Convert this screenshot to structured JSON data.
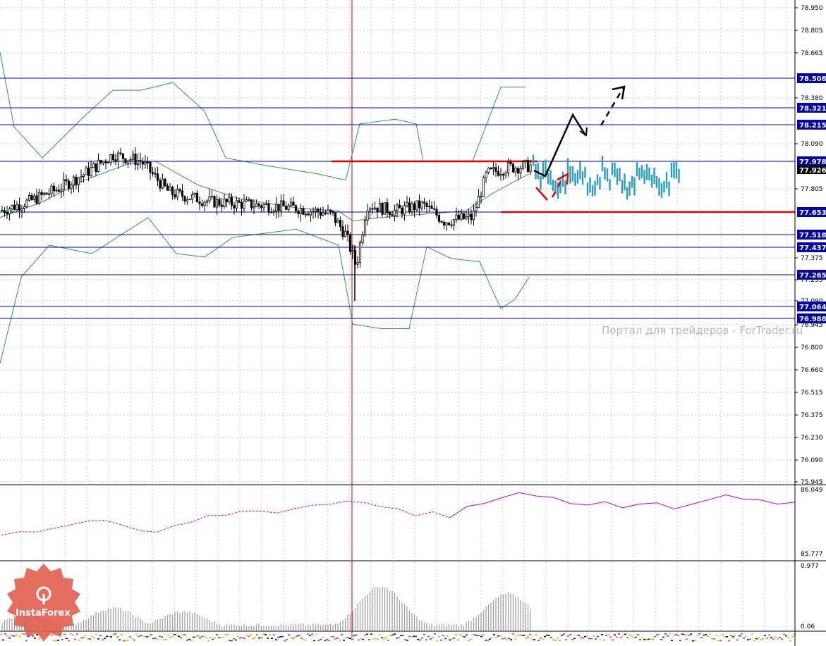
{
  "colors": {
    "background": "#ffffff",
    "grid": "#c8c8c8",
    "level_line": "#0000aa",
    "support_resistance": "#e00000",
    "bollinger": "#2e9a52",
    "candles": "#000000",
    "forecast": "#2a9bc0",
    "oscillator": "#cc00cc",
    "event_line": "#cc0000",
    "badge_bg": "#0000aa",
    "current_badge_bg": "#000000",
    "brand": "#e05a4a"
  },
  "watermark": "Портал для трейдеров - ForTrader.ru",
  "brand_logo": "InstaForex",
  "chart_data": [
    {
      "type": "candlestick",
      "panel": "price",
      "ylim": [
        75.945,
        78.95
      ],
      "y_ticks": [
        "78.950",
        "78.805",
        "78.665",
        "78.380",
        "78.090",
        "77.805",
        "77.375",
        "77.235",
        "77.090",
        "76.945",
        "76.800",
        "76.660",
        "76.515",
        "76.375",
        "76.230",
        "76.090",
        "75.945"
      ],
      "levels": [
        {
          "label": "78.508",
          "value": 78.508
        },
        {
          "label": "78.321",
          "value": 78.321
        },
        {
          "label": "78.215",
          "value": 78.215
        },
        {
          "label": "77.978",
          "value": 77.978
        },
        {
          "label": "77.653",
          "value": 77.653
        },
        {
          "label": "77.518",
          "value": 77.518
        },
        {
          "label": "77.437",
          "value": 77.437
        },
        {
          "label": "77.265",
          "value": 77.265
        },
        {
          "label": "77.064",
          "value": 77.064
        },
        {
          "label": "76.988",
          "value": 76.988
        }
      ],
      "current_price": {
        "label": "77.926",
        "value": 77.926
      },
      "resistance_value": 77.978,
      "support_value": 77.653,
      "grid": true
    },
    {
      "type": "line",
      "panel": "oscillator",
      "ylim": [
        85.777,
        86.049
      ],
      "y_ticks": [
        "86.049",
        "85.777"
      ],
      "series": [
        {
          "values": [
            85.86,
            85.87,
            85.88,
            85.89,
            85.9,
            85.92,
            85.93,
            85.91,
            85.88,
            85.87,
            85.9,
            85.92,
            85.94,
            85.95,
            85.96,
            85.97,
            85.96,
            85.98,
            85.99,
            86.0,
            86.01,
            86.0,
            85.99,
            85.97,
            85.95,
            85.96,
            85.94,
            85.98,
            86.0,
            86.02,
            86.04,
            86.03,
            86.02,
            86.0,
            85.99,
            86.0,
            85.98,
            85.99,
            86.0,
            85.97,
            86.0,
            86.02,
            86.03,
            86.02,
            86.01,
            86.0,
            86.01
          ]
        }
      ]
    },
    {
      "type": "bar",
      "panel": "volume",
      "ylim": [
        0.06,
        0.977
      ],
      "y_ticks": [
        "0.977",
        "0.06"
      ]
    }
  ]
}
